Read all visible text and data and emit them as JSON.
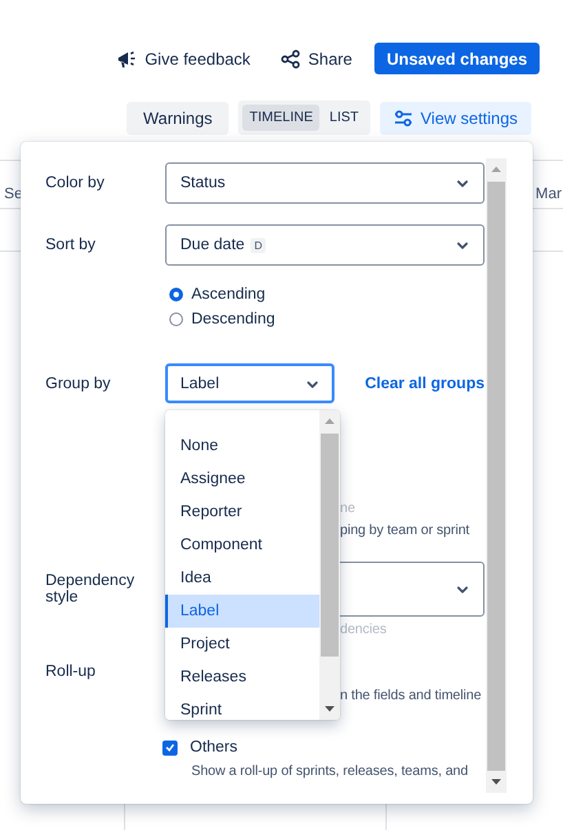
{
  "header": {
    "actions": [
      {
        "kind": "feedback",
        "label": "Give feedback"
      },
      {
        "kind": "share",
        "label": "Share"
      },
      {
        "kind": "primary",
        "label": "Unsaved changes"
      }
    ]
  },
  "toolbar": {
    "warnings": "Warnings",
    "view_toggle": [
      {
        "label": "TIMELINE",
        "selected": true
      },
      {
        "label": "LIST",
        "selected": false
      }
    ],
    "view_settings": "View settings"
  },
  "timeline": {
    "months": [
      "Se",
      "Mar"
    ]
  },
  "settings_panel": {
    "color_by": {
      "label": "Color by",
      "value": "Status"
    },
    "sort_by": {
      "label": "Sort by",
      "value": "Due date",
      "badge": "D",
      "order": [
        {
          "label": "Ascending",
          "selected": true
        },
        {
          "label": "Descending",
          "selected": false
        }
      ]
    },
    "group_by": {
      "label": "Group by",
      "value": "Label",
      "expanded": true,
      "clear_link": "Clear all groups",
      "options": [
        {
          "label": "None",
          "selected": false
        },
        {
          "label": "Assignee",
          "selected": false
        },
        {
          "label": "Reporter",
          "selected": false
        },
        {
          "label": "Component",
          "selected": false
        },
        {
          "label": "Idea",
          "selected": false
        },
        {
          "label": "Label",
          "selected": true
        },
        {
          "label": "Project",
          "selected": false
        },
        {
          "label": "Releases",
          "selected": false
        },
        {
          "label": "Sprint",
          "selected": false
        }
      ],
      "hints": [
        {
          "text": "ne",
          "disabled": true
        },
        {
          "text": "ping by team or sprint",
          "disabled": false
        }
      ]
    },
    "dependency_style": {
      "label": "Dependency style",
      "hints": [
        {
          "text": "dencies",
          "disabled": true
        }
      ]
    },
    "roll_up": {
      "label": "Roll-up",
      "hints": [
        {
          "text": "n the fields and timeline",
          "disabled": false
        }
      ],
      "options": [
        {
          "label": "Others",
          "checked": true,
          "description": "Show a roll-up of sprints, releases, teams, and"
        }
      ]
    }
  }
}
